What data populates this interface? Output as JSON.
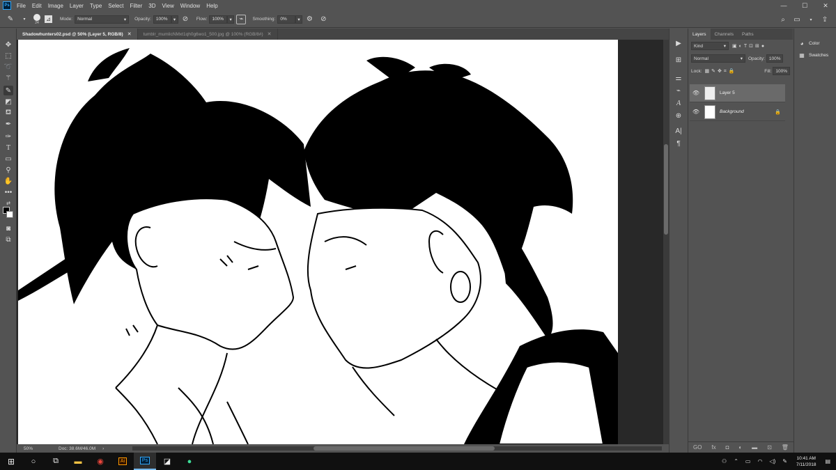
{
  "app": {
    "logo_text": "Ps",
    "menu": [
      "File",
      "Edit",
      "Image",
      "Layer",
      "Type",
      "Select",
      "Filter",
      "3D",
      "View",
      "Window",
      "Help"
    ]
  },
  "window_controls": {
    "minimize": "—",
    "maximize": "☐",
    "close": "✕"
  },
  "options_bar": {
    "brush_size": "24",
    "mode_label": "Mode:",
    "mode_value": "Normal",
    "opacity_label": "Opacity:",
    "opacity_value": "100%",
    "flow_label": "Flow:",
    "flow_value": "100%",
    "smoothing_label": "Smoothing:",
    "smoothing_value": "0%"
  },
  "tabs": [
    {
      "label": "Shadowhunters02.psd @ 50% (Layer 5, RGB/8)",
      "close": "✕"
    },
    {
      "label": "tumblr_mumlicNMxt1qh0g6wo1_500.jpg @ 100% (RGB/8#)",
      "close": "✕"
    }
  ],
  "status": {
    "zoom": "50%",
    "doc": "Doc: 38.6M/46.0M",
    "arrow": "›"
  },
  "layers_panel": {
    "tabs": [
      "Layers",
      "Channels",
      "Paths"
    ],
    "kind": "Kind",
    "blend": "Normal",
    "opacity_label": "Opacity:",
    "opacity_value": "100%",
    "lock_label": "Lock:",
    "fill_label": "Fill:",
    "fill_value": "100%",
    "layers": [
      {
        "name": "Layer 5"
      },
      {
        "name": "Background"
      }
    ],
    "footer": [
      "GO",
      "fx",
      "◘",
      "◐",
      "▬",
      "⊡",
      "🗑"
    ]
  },
  "color_panel": {
    "items": [
      "Color",
      "Swatches"
    ]
  },
  "taskbar": {
    "time": "10:41 AM",
    "date": "7/11/2018"
  }
}
